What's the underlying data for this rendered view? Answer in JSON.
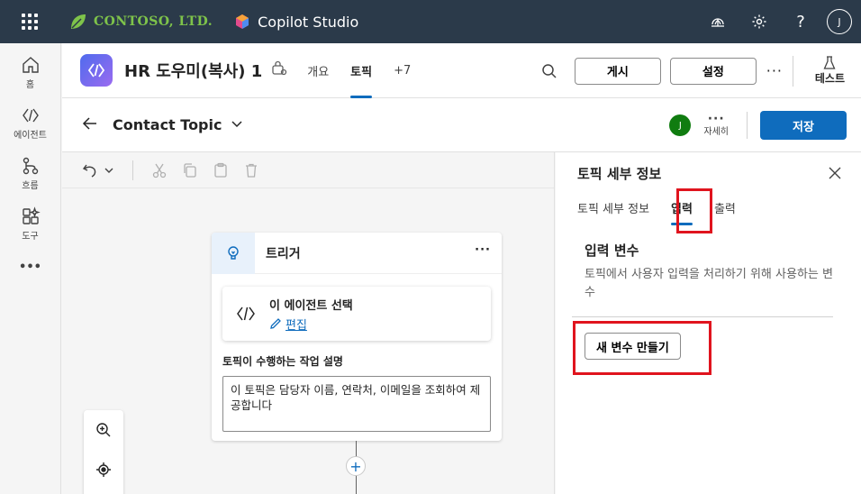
{
  "topbar": {
    "company": "CONTOSO, LTD.",
    "product": "Copilot Studio",
    "avatar": "J",
    "help": "?"
  },
  "rail": {
    "items": [
      {
        "label": "홈",
        "icon": "home-icon"
      },
      {
        "label": "에이전트",
        "icon": "agent-icon"
      },
      {
        "label": "흐름",
        "icon": "flow-icon"
      },
      {
        "label": "도구",
        "icon": "tools-icon"
      }
    ],
    "more": "•••"
  },
  "header": {
    "agent_title": "HR 도우미(복사) 1",
    "tabs": [
      {
        "label": "개요",
        "active": false
      },
      {
        "label": "토픽",
        "active": true
      },
      {
        "label": "+7",
        "active": false
      }
    ],
    "publish": "게시",
    "settings": "설정",
    "more": "···",
    "test": "테스트"
  },
  "topic_bar": {
    "name": "Contact Topic",
    "avatar": "J",
    "details_label": "자세히",
    "details_dots": "···",
    "save": "저장"
  },
  "canvas": {
    "node": {
      "title": "트리거",
      "more": "···",
      "trigger_title": "이 에이전트 선택",
      "edit": "편집",
      "desc_label": "토픽이 수행하는 작업 설명",
      "desc_text": "이 토픽은 담당자 이름, 연락처, 이메일을 조회하여 제공합니다"
    },
    "plus": "+"
  },
  "panel": {
    "title": "토픽 세부 정보",
    "tabs": [
      {
        "label": "토픽 세부 정보",
        "active": false
      },
      {
        "label": "입력",
        "active": true
      },
      {
        "label": "출력",
        "active": false
      }
    ],
    "section_title": "입력 변수",
    "section_desc": "토픽에서 사용자 입력을 처리하기 위해 사용하는 변수",
    "new_variable": "새 변수 만들기"
  },
  "colors": {
    "topbar": "#2b3a4a",
    "accent": "#0f6cbd",
    "highlight": "#e0141e",
    "brand_green": "#7ec34a"
  }
}
